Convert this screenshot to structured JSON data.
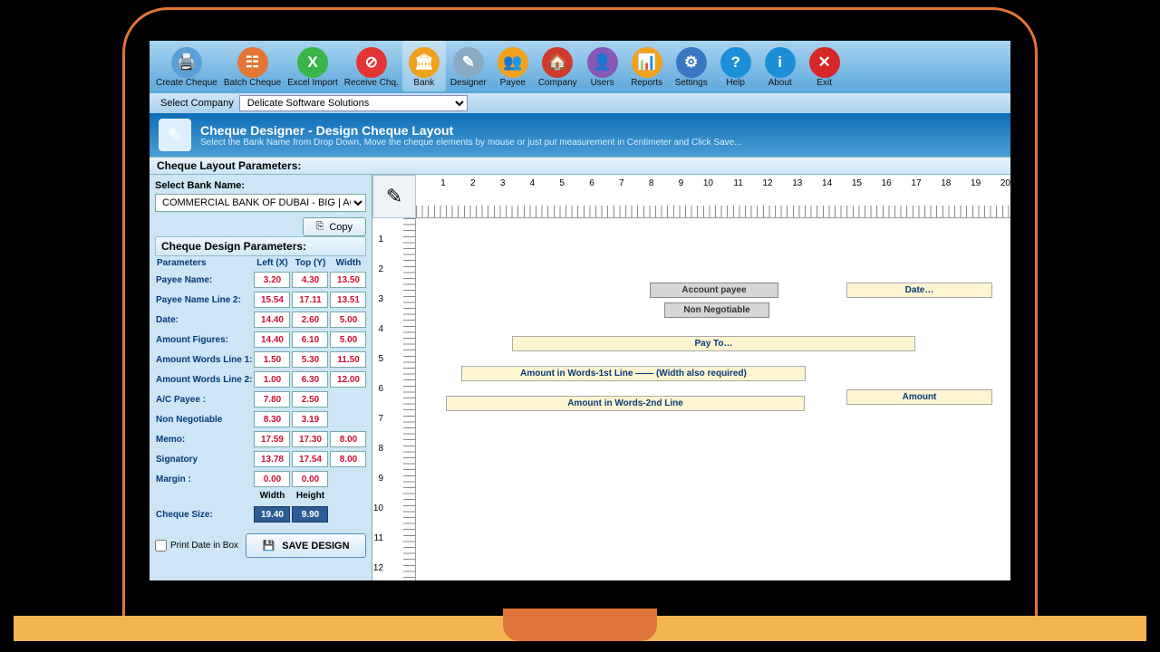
{
  "site_url": "www.DelicateSoft.com",
  "toolbar": [
    {
      "label": "Create Cheque",
      "name": "create-cheque-button",
      "icon": "🖨️",
      "bg": "#5aa0d8"
    },
    {
      "label": "Batch Cheque",
      "name": "batch-cheque-button",
      "icon": "☷",
      "bg": "#e57535"
    },
    {
      "label": "Excel Import",
      "name": "excel-import-button",
      "icon": "X",
      "bg": "#3ab54a"
    },
    {
      "label": "Receive Chq.",
      "name": "receive-cheque-button",
      "icon": "⊘",
      "bg": "#e43434"
    },
    {
      "label": "Bank",
      "name": "bank-button",
      "icon": "🏛",
      "bg": "#f2a11e",
      "active": true
    },
    {
      "label": "Designer",
      "name": "designer-button",
      "icon": "✎",
      "bg": "#8aa9c2"
    },
    {
      "label": "Payee",
      "name": "payee-button",
      "icon": "👥",
      "bg": "#f2a11e"
    },
    {
      "label": "Company",
      "name": "company-button",
      "icon": "🏠",
      "bg": "#d03a2c"
    },
    {
      "label": "Users",
      "name": "users-button",
      "icon": "👤",
      "bg": "#8658b8"
    },
    {
      "label": "Reports",
      "name": "reports-button",
      "icon": "📊",
      "bg": "#f2a11e"
    },
    {
      "label": "Settings",
      "name": "settings-button",
      "icon": "⚙",
      "bg": "#3a77c2"
    },
    {
      "label": "Help",
      "name": "help-button",
      "icon": "?",
      "bg": "#1d8fd8"
    },
    {
      "label": "About",
      "name": "about-button",
      "icon": "i",
      "bg": "#1d8fd8"
    },
    {
      "label": "Exit",
      "name": "exit-button",
      "icon": "✕",
      "bg": "#d62828"
    }
  ],
  "company": {
    "label": "Select Company",
    "value": "Delicate Software Solutions"
  },
  "banner": {
    "title": "Cheque Designer - Design Cheque Layout",
    "subtitle": "Select the Bank Name from Drop Down, Move the cheque elements by mouse or just put measurement in Centimeter and Click Save..."
  },
  "section_title": "Cheque Layout Parameters:",
  "left": {
    "select_bank_label": "Select Bank Name:",
    "bank_value": "COMMERCIAL BANK OF DUBAI - BIG | AC",
    "copy_label": "Copy",
    "design_params_title": "Cheque Design Parameters:",
    "headers": {
      "p": "Parameters",
      "l": "Left (X)",
      "t": "Top (Y)",
      "w": "Width"
    },
    "rows": [
      {
        "label": "Payee Name:",
        "l": "3.20",
        "t": "4.30",
        "w": "13.50"
      },
      {
        "label": "Payee Name Line 2:",
        "l": "15.54",
        "t": "17.11",
        "w": "13.51"
      },
      {
        "label": "Date:",
        "l": "14.40",
        "t": "2.60",
        "w": "5.00"
      },
      {
        "label": "Amount Figures:",
        "l": "14.40",
        "t": "6.10",
        "w": "5.00"
      },
      {
        "label": "Amount Words Line 1:",
        "l": "1.50",
        "t": "5.30",
        "w": "11.50"
      },
      {
        "label": "Amount Words Line 2:",
        "l": "1.00",
        "t": "6.30",
        "w": "12.00"
      },
      {
        "label": "A/C Payee :",
        "l": "7.80",
        "t": "2.50",
        "w": ""
      },
      {
        "label": "Non Negotiable",
        "l": "8.30",
        "t": "3.19",
        "w": ""
      },
      {
        "label": "Memo:",
        "l": "17.59",
        "t": "17.30",
        "w": "8.00"
      },
      {
        "label": "Signatory",
        "l": "13.78",
        "t": "17.54",
        "w": "8.00"
      },
      {
        "label": "Margin :",
        "l": "0.00",
        "t": "0.00",
        "w": ""
      }
    ],
    "size_headers": {
      "w": "Width",
      "h": "Height"
    },
    "cheque_size_label": "Cheque Size:",
    "cheque_size": {
      "w": "19.40",
      "h": "9.90"
    },
    "print_date_label": "Print Date in Box",
    "save_label": "SAVE DESIGN"
  },
  "canvas": {
    "ruler_top": [
      "1",
      "2",
      "3",
      "4",
      "5",
      "6",
      "7",
      "8",
      "9",
      "10",
      "11",
      "12",
      "13",
      "14",
      "15",
      "16",
      "17",
      "18",
      "19",
      "20"
    ],
    "ruler_left": [
      "1",
      "2",
      "3",
      "4",
      "5",
      "6",
      "7",
      "8",
      "9",
      "10",
      "11",
      "12"
    ],
    "elements": {
      "account_payee": "Account payee",
      "non_negotiable": "Non Negotiable",
      "date": "Date…",
      "pay_to": "Pay To…",
      "amount_words_1": "Amount in Words-1st Line      —— (Width also required)",
      "amount_words_2": "Amount in Words-2nd Line",
      "amount": "Amount"
    }
  }
}
